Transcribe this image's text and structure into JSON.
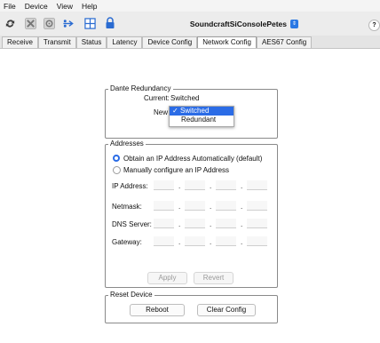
{
  "menu": [
    "File",
    "Device",
    "View",
    "Help"
  ],
  "toolbar": {
    "device_name": "SoundcraftSiConsolePetes",
    "help_label": "?",
    "icons": [
      "refresh-icon",
      "tools-icon",
      "device-settings-icon",
      "network-icon",
      "grid-icon",
      "lock-icon"
    ]
  },
  "tabs": [
    "Receive",
    "Transmit",
    "Status",
    "Latency",
    "Device Config",
    "Network Config",
    "AES67 Config"
  ],
  "active_tab": "Network Config",
  "dante_redundancy": {
    "title": "Dante Redundancy",
    "current_label": "Current:",
    "current_value": "Switched",
    "new_label": "New",
    "options": [
      "Switched",
      "Redundant"
    ],
    "selected": "Switched",
    "check_mark": "✓"
  },
  "addresses": {
    "title": "Addresses",
    "option_auto": "Obtain an IP Address Automatically (default)",
    "option_manual": "Manually configure an IP Address",
    "selected": "auto",
    "fields": [
      "IP Address:",
      "Netmask:",
      "DNS Server:",
      "Gateway:"
    ],
    "apply_label": "Apply",
    "revert_label": "Revert"
  },
  "reset_device": {
    "title": "Reset Device",
    "reboot_label": "Reboot",
    "clear_label": "Clear Config"
  },
  "colors": {
    "accent": "#2b6ce6"
  }
}
